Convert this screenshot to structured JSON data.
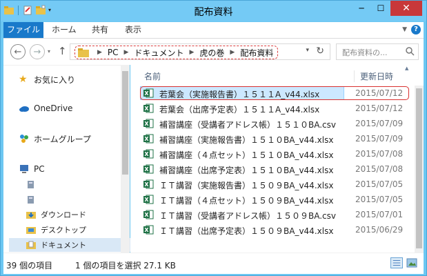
{
  "window": {
    "title": "配布資料"
  },
  "ribbon": {
    "tabs": [
      "ファイル",
      "ホーム",
      "共有",
      "表示"
    ]
  },
  "address": {
    "segments": [
      "PC",
      "ドキュメント",
      "虎の巻",
      "配布資料"
    ],
    "search_placeholder": "配布資料の..."
  },
  "navpane": {
    "favorites": "お気に入り",
    "onedrive": "OneDrive",
    "homegroup": "ホームグループ",
    "pc": "PC",
    "downloads": "ダウンロード",
    "desktop": "デスクトップ",
    "documents": "ドキュメント"
  },
  "columns": {
    "name": "名前",
    "date": "更新日時"
  },
  "files": [
    {
      "name": "若葉会（実施報告書）１５１１A_v44.xlsx",
      "date": "2015/07/12"
    },
    {
      "name": "若葉会（出席予定表）１５１１A_v44.xlsx",
      "date": "2015/07/12"
    },
    {
      "name": "補習講座（受講者アドレス帳）１５１０BA.csv",
      "date": "2015/07/09"
    },
    {
      "name": "補習講座（実施報告書）１５１０BA_v44.xlsx",
      "date": "2015/07/09"
    },
    {
      "name": "補習講座（４点セット）１５１０BA_v44.xlsx",
      "date": "2015/07/08"
    },
    {
      "name": "補習講座（出席予定表）１５１０BA_v44.xlsx",
      "date": "2015/07/08"
    },
    {
      "name": "ＩＴ講習（実施報告書）１５０９BA_v44.xlsx",
      "date": "2015/07/05"
    },
    {
      "name": "ＩＴ講習（４点セット）１５０９BA_v44.xlsx",
      "date": "2015/07/05"
    },
    {
      "name": "ＩＴ講習（受講者アドレス帳）１５０９BA.csv",
      "date": "2015/07/01"
    },
    {
      "name": "ＩＴ講習（出席予定表）１５０９BA_v44.xlsx",
      "date": "2015/06/29"
    }
  ],
  "status": {
    "item_count": "39 個の項目",
    "selection": "1 個の項目を選択  27.1 KB"
  }
}
